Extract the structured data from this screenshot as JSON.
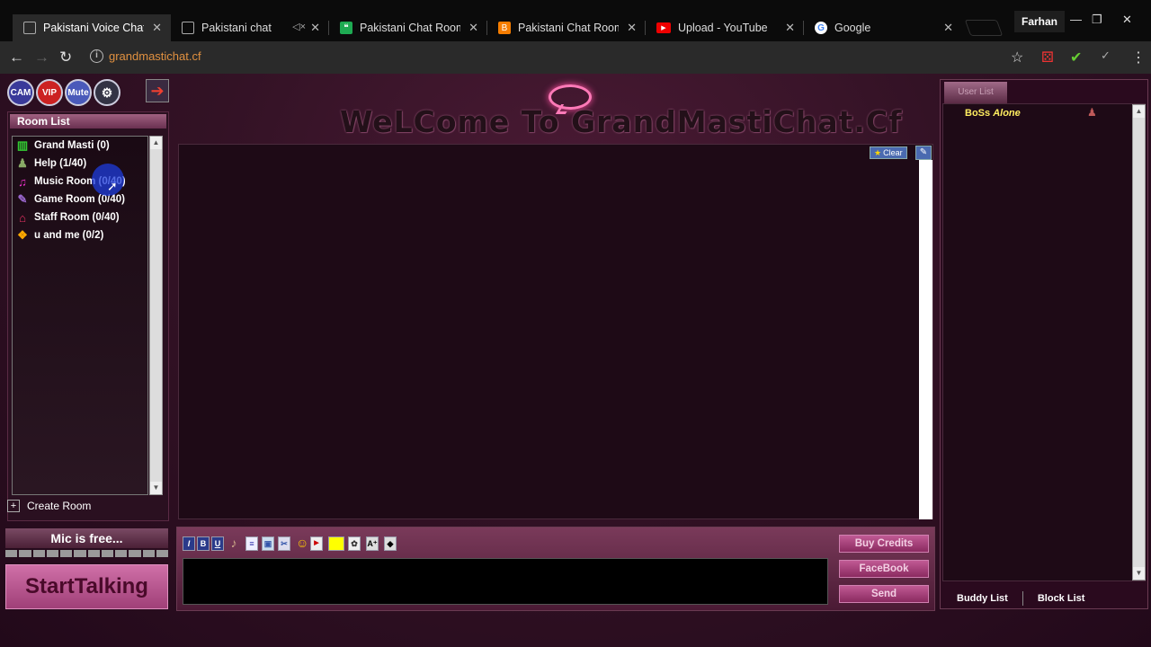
{
  "browser": {
    "tabs": [
      {
        "title": "Pakistani Voice Chat |",
        "active": true,
        "icon": "page-icon"
      },
      {
        "title": "Pakistani chat",
        "active": false,
        "icon": "page-icon",
        "muted": true
      },
      {
        "title": "Pakistani Chat Room",
        "active": false,
        "icon": "hangouts-icon"
      },
      {
        "title": "Pakistani Chat Rooms",
        "active": false,
        "icon": "blogger-icon"
      },
      {
        "title": "Upload - YouTube",
        "active": false,
        "icon": "youtube-icon"
      },
      {
        "title": "Google",
        "active": false,
        "icon": "google-icon"
      }
    ],
    "user": "Farhan",
    "url": "grandmastichat.cf",
    "colors": {
      "url": "#e09040",
      "active_tab": "#2a2a2a"
    }
  },
  "toolbar": {
    "cam": "CAM",
    "vip": "VIP",
    "mute": "Mute"
  },
  "banner": {
    "welcome": "WeLCome To GrandMastiChat.Cf"
  },
  "rooms": {
    "header": "Room List",
    "items": [
      {
        "label": "Grand Masti (0)",
        "icon": "building-icon"
      },
      {
        "label": "Help (1/40)",
        "icon": "person-icon"
      },
      {
        "label": "Music Room (0/40)",
        "icon": "music-note-icon"
      },
      {
        "label": "Game Room (0/40)",
        "icon": "gamepad-icon"
      },
      {
        "label": "Staff Room (0/40)",
        "icon": "house-icon"
      },
      {
        "label": "u and me (0/2)",
        "icon": "gift-icon"
      }
    ],
    "create": "Create Room"
  },
  "mic": {
    "status": "Mic is free...",
    "start": "StartTalking"
  },
  "chat": {
    "clear": "Clear",
    "buttons": {
      "credits": "Buy Credits",
      "facebook": "FaceBook",
      "send": "Send"
    },
    "format": [
      "I",
      "B",
      "U"
    ]
  },
  "users": {
    "header": "User List",
    "list": [
      {
        "name": "BoSs",
        "name2": "Alone"
      }
    ],
    "buddy": "Buddy List",
    "block": "Block List"
  }
}
